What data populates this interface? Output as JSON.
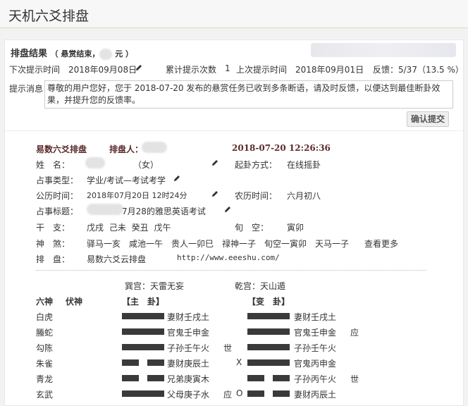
{
  "app": {
    "title": "天机六爻排盘"
  },
  "result": {
    "title": "排盘结果",
    "sub_prefix": "（ 悬赏结束，",
    "sub_suffix": " 元 ）",
    "next_hint_label": "下次提示时间",
    "next_hint_value": "2018年09月08日",
    "total_hint_label": "累计提示次数",
    "total_hint_value": "1",
    "last_hint_label": "上次提示时间",
    "last_hint_value": "2018年09月01日",
    "feedback": "反馈：5/37（13.5 %）",
    "msg_label": "提示消息",
    "msg_text": "尊敬的用户您好，您于 2018-07-20 发布的悬赏任务已收到多条断语，请及时反馈，以便达到最佳断卦效果，并提升您的反馈率。",
    "confirm_label": "确认提交"
  },
  "pan": {
    "header_left": "易数六爻排盘",
    "person_label": "排盘人：",
    "datetime": "2018-07-20 12:26:36",
    "name_label": "姓　名：",
    "name_value": "（女）",
    "method_label": "起卦方式：",
    "method_value": "在线摇卦",
    "type_label": "占事类型：",
    "type_value": "学业/考试—考试考学",
    "solar_label": "公历时间：",
    "solar_value": "2018年07月20日 12时24分",
    "lunar_label": "农历时间：",
    "lunar_value": "六月初八",
    "topic_label": "占事标题：",
    "topic_value": "7月28的雅思英语考试",
    "ganzhi_label": "干　支：",
    "ganzhi_value": "戊戌  己未  癸丑  戊午",
    "xunkong_label": "旬　空：",
    "xunkong_value": "寅卯",
    "shensha_label": "神　煞：",
    "shensha_items": [
      "驿马一亥",
      "咸池一午",
      "贵人一卯巳",
      "禄神一子",
      "旬空一寅卯",
      "天马一子"
    ],
    "more_label": "查看更多",
    "paipan_label": "排　盘：",
    "paipan_value": "易数六爻云排盘",
    "url": "http://www.eeeshu.com/",
    "gong_left": "巽宫：天雷无妄",
    "gong_right": "乾宫：天山遁",
    "col_liushen": "六神",
    "col_fushen": "伏神",
    "col_main": "【主　卦】",
    "col_change": "【变　卦】",
    "rows": [
      {
        "shen": "白虎",
        "main_yao": "yang",
        "main_text": "妻财壬戌土",
        "shi": "",
        "mark": "",
        "chg_yao": "yang",
        "chg_text": "妻财壬戌土",
        "chg_shi": ""
      },
      {
        "shen": "螣蛇",
        "main_yao": "yang",
        "main_text": "官鬼壬申金",
        "shi": "",
        "mark": "",
        "chg_yao": "yang",
        "chg_text": "官鬼壬申金",
        "chg_shi": "应"
      },
      {
        "shen": "勾陈",
        "main_yao": "yang",
        "main_text": "子孙壬午火",
        "shi": "世",
        "mark": "",
        "chg_yao": "yang",
        "chg_text": "子孙壬午火",
        "chg_shi": ""
      },
      {
        "shen": "朱雀",
        "main_yao": "yin",
        "main_text": "妻财庚辰土",
        "shi": "",
        "mark": "X",
        "chg_yao": "yang",
        "chg_text": "官鬼丙申金",
        "chg_shi": ""
      },
      {
        "shen": "青龙",
        "main_yao": "yin",
        "main_text": "兄弟庚寅木",
        "shi": "",
        "mark": "",
        "chg_yao": "yin",
        "chg_text": "子孙丙午火",
        "chg_shi": "世"
      },
      {
        "shen": "玄武",
        "main_yao": "yang",
        "main_text": "父母庚子水",
        "shi": "应",
        "mark": "O",
        "chg_yao": "yin",
        "chg_text": "妻财丙辰土",
        "chg_shi": ""
      }
    ]
  },
  "colors": {
    "pan_header": "#5a2a2a",
    "yao": "#3a3a3a",
    "topbar_border": "#e5d9b0"
  }
}
